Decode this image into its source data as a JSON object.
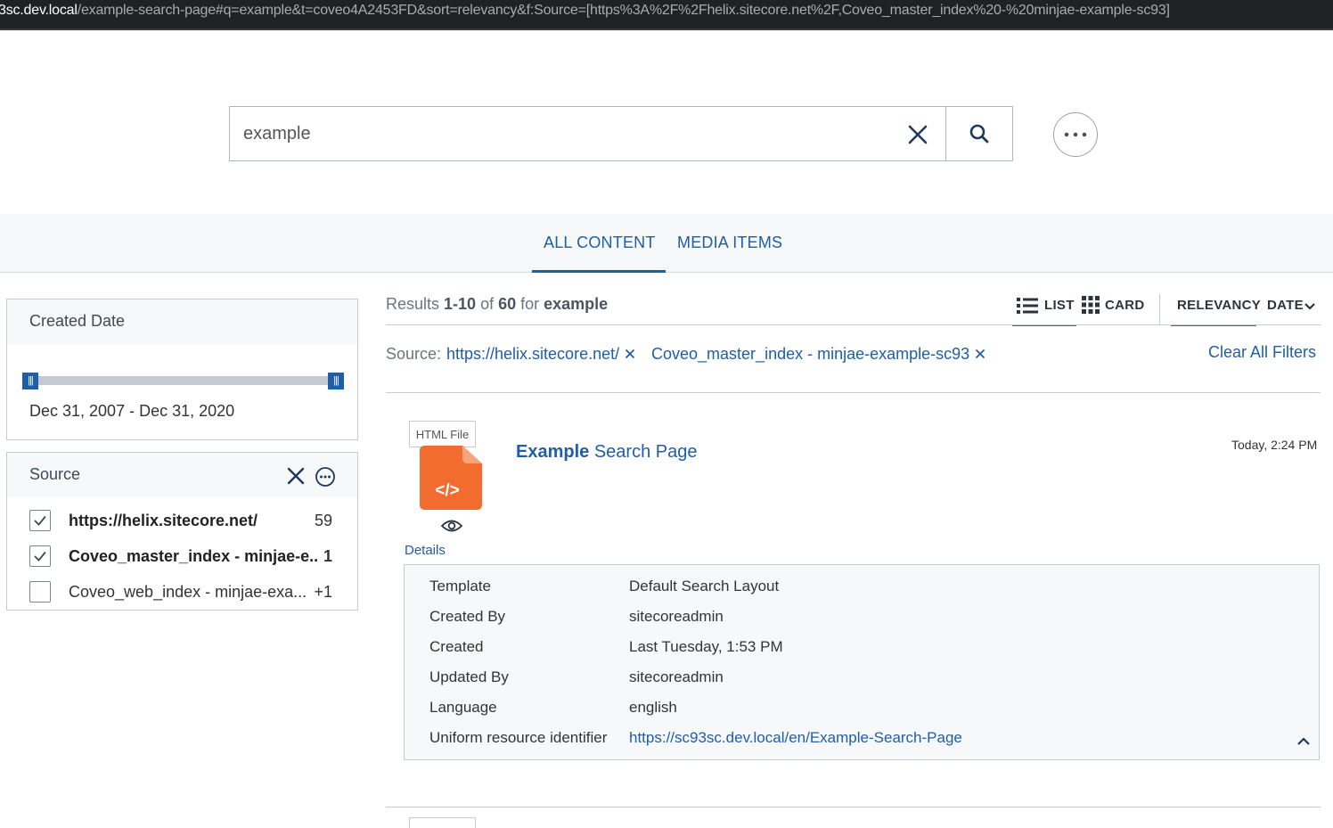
{
  "browser": {
    "url_host": "3sc.dev.local",
    "url_rest": "/example-search-page#q=example&t=coveo4A2453FD&sort=relevancy&f:Source=[https%3A%2F%2Fhelix.sitecore.net%2F,Coveo_master_index%20-%20minjae-example-sc93]"
  },
  "search": {
    "query": "example",
    "clear_icon": "close-icon",
    "search_icon": "magnifier-icon",
    "more_icon": "ellipsis-icon"
  },
  "tabs": [
    {
      "label": "ALL CONTENT",
      "active": true
    },
    {
      "label": "MEDIA ITEMS",
      "active": false
    }
  ],
  "facets": {
    "created_date": {
      "title": "Created Date",
      "range_text": "Dec 31, 2007 - Dec 31, 2020",
      "handle_left_glyph": "|||",
      "handle_right_glyph": "|||"
    },
    "source": {
      "title": "Source",
      "items": [
        {
          "label": "https://helix.sitecore.net/",
          "count": "59",
          "checked": true
        },
        {
          "label": "Coveo_master_index - minjae-e...",
          "count": "1",
          "checked": true
        },
        {
          "label": "Coveo_web_index - minjae-exa...",
          "count": "+1",
          "checked": false
        }
      ]
    }
  },
  "results_header": {
    "summary_prefix": "Results ",
    "range_start": "1",
    "range_sep": "-",
    "range_end": "10",
    "of_text": " of ",
    "total": "60",
    "for_text": " for ",
    "query": "example",
    "layout_list": "LIST",
    "layout_card": "CARD",
    "sort_relevancy": "RELEVANCY",
    "sort_date": "DATE"
  },
  "breadcrumb": {
    "label": "Source:",
    "items": [
      "https://helix.sitecore.net/",
      "Coveo_master_index - minjae-example-sc93"
    ],
    "clear_all": "Clear All Filters"
  },
  "result": {
    "file_type": "HTML File",
    "file_icon_glyph": "</>",
    "title_highlight": "Example",
    "title_rest": " Search Page",
    "date": "Today, 2:24 PM",
    "details_label": "Details",
    "details": [
      {
        "key": "Template",
        "value": "Default Search Layout",
        "link": false
      },
      {
        "key": "Created By",
        "value": "sitecoreadmin",
        "link": false
      },
      {
        "key": "Created",
        "value": "Last Tuesday, 1:53 PM",
        "link": false
      },
      {
        "key": "Updated By",
        "value": "sitecoreadmin",
        "link": false
      },
      {
        "key": "Language",
        "value": "english",
        "link": false
      },
      {
        "key": "Uniform resource identifier",
        "value": "https://sc93sc.dev.local/en/Example-Search-Page",
        "link": true
      }
    ]
  },
  "colors": {
    "accent": "#1f5ea8",
    "file_icon": "#f26b2f",
    "panel_bg": "#f6f8f9"
  }
}
